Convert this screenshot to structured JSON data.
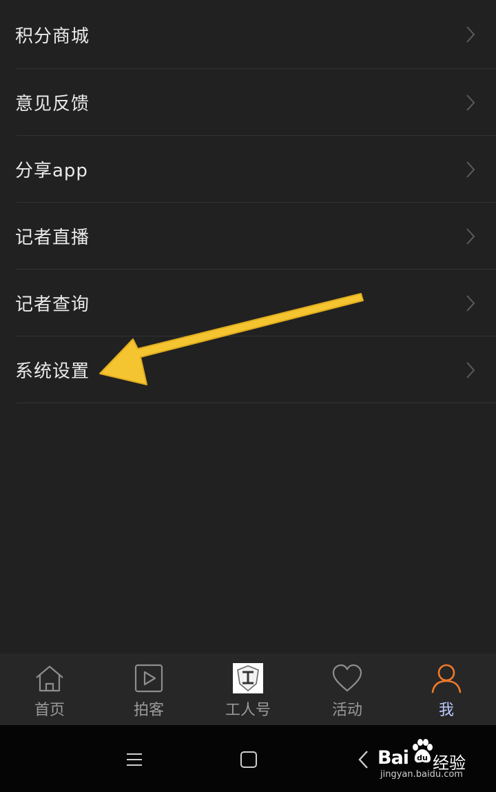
{
  "menu": {
    "items": [
      {
        "label": "积分商城"
      },
      {
        "label": "意见反馈"
      },
      {
        "label": "分享app"
      },
      {
        "label": "记者直播"
      },
      {
        "label": "记者查询"
      },
      {
        "label": "系统设置"
      }
    ]
  },
  "tabbar": {
    "tabs": [
      {
        "label": "首页",
        "icon": "home-icon"
      },
      {
        "label": "拍客",
        "icon": "play-icon"
      },
      {
        "label": "工人号",
        "icon": "worker-logo-icon"
      },
      {
        "label": "活动",
        "icon": "heart-icon"
      },
      {
        "label": "我",
        "icon": "person-icon"
      }
    ],
    "active_index": 4,
    "colors": {
      "active_icon": "#f07a2a",
      "active_label": "#b9c8ff",
      "inactive": "#9a9a9a"
    }
  },
  "annotation": {
    "arrow_color": "#f5c431",
    "target": "系统设置"
  },
  "navbar": {
    "buttons": [
      "menu-icon",
      "home-square-icon",
      "back-icon"
    ]
  },
  "watermark": {
    "brand_text": "Bai",
    "cn_text": "经验",
    "url": "jingyan.baidu.com"
  }
}
